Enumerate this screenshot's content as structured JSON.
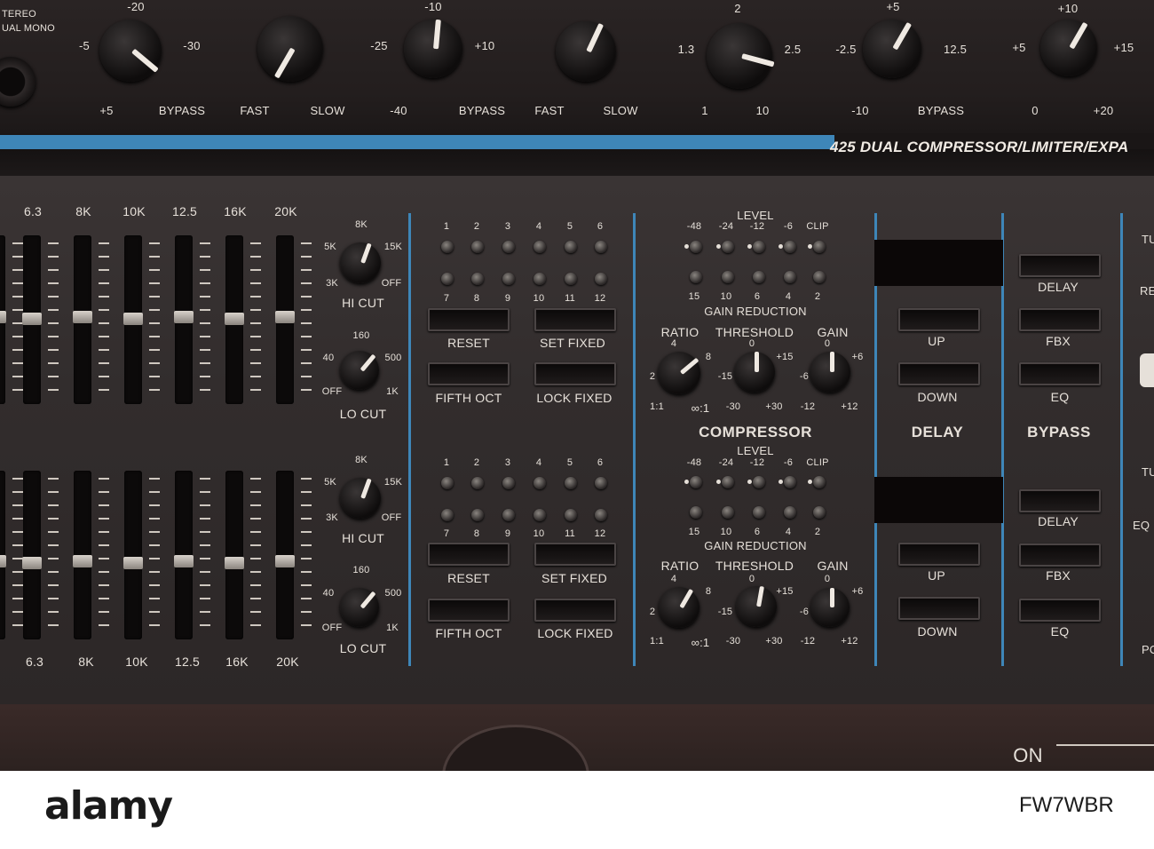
{
  "device": {
    "model_text": "425 DUAL COMPRESSOR/LIMITER/EXPA",
    "top_partial": [
      "TEREO",
      "UAL MONO"
    ],
    "top_labels": [
      "-20",
      "-5",
      "-30",
      "+5",
      "BYPASS",
      "FAST",
      "SLOW",
      "-10",
      "-25",
      "+10",
      "-40",
      "BYPASS",
      "FAST",
      "SLOW",
      "2",
      "1.3",
      "2.5",
      "1",
      "10",
      "+5",
      "-2.5",
      "12.5",
      "-10",
      "BYPASS",
      "+10",
      "+5",
      "+15",
      "0",
      "+20"
    ],
    "eq_freqs_top": [
      "6.3",
      "8K",
      "10K",
      "12.5",
      "16K",
      "20K"
    ],
    "eq_freqs_bottom": [
      "6.3",
      "8K",
      "10K",
      "12.5",
      "16K",
      "20K"
    ],
    "hicut": {
      "title": "HI CUT",
      "marks": [
        "8K",
        "5K",
        "15K",
        "3K",
        "OFF"
      ]
    },
    "locut": {
      "title": "LO CUT",
      "marks": [
        "160",
        "40",
        "500",
        "OFF",
        "1K"
      ]
    },
    "fbx": {
      "led_numbers_top": [
        "1",
        "2",
        "3",
        "4",
        "5",
        "6"
      ],
      "led_numbers_bottom": [
        "7",
        "8",
        "9",
        "10",
        "11",
        "12"
      ],
      "reset": "RESET",
      "set_fixed": "SET FIXED",
      "fifth_oct": "FIFTH OCT",
      "lock_fixed": "LOCK FIXED"
    },
    "compressor": {
      "level": "LEVEL",
      "level_marks": [
        "-48",
        "-24",
        "-12",
        "-6",
        "CLIP"
      ],
      "gr_marks": [
        "15",
        "10",
        "6",
        "4",
        "2"
      ],
      "gain_reduction": "GAIN REDUCTION",
      "ratio": "RATIO",
      "ratio_marks": [
        "4",
        "8",
        "2",
        "1:1",
        "∞:1"
      ],
      "threshold": "THRESHOLD",
      "threshold_marks": [
        "0",
        "-15",
        "+15",
        "-30",
        "+30"
      ],
      "gain": "GAIN",
      "gain_marks": [
        "0",
        "-6",
        "+6",
        "-12",
        "+12"
      ],
      "title": "COMPRESSOR"
    },
    "delay": {
      "up": "UP",
      "down": "DOWN",
      "title": "DELAY"
    },
    "bypass": {
      "delay": "DELAY",
      "fbx": "FBX",
      "eq": "EQ",
      "title": "BYPASS"
    },
    "right_edge": [
      "TU",
      "RE",
      "TU",
      "EQ",
      "PO"
    ],
    "on_label": "ON"
  },
  "watermark": {
    "brand": "alamy",
    "image_id": "FW7WBR"
  }
}
